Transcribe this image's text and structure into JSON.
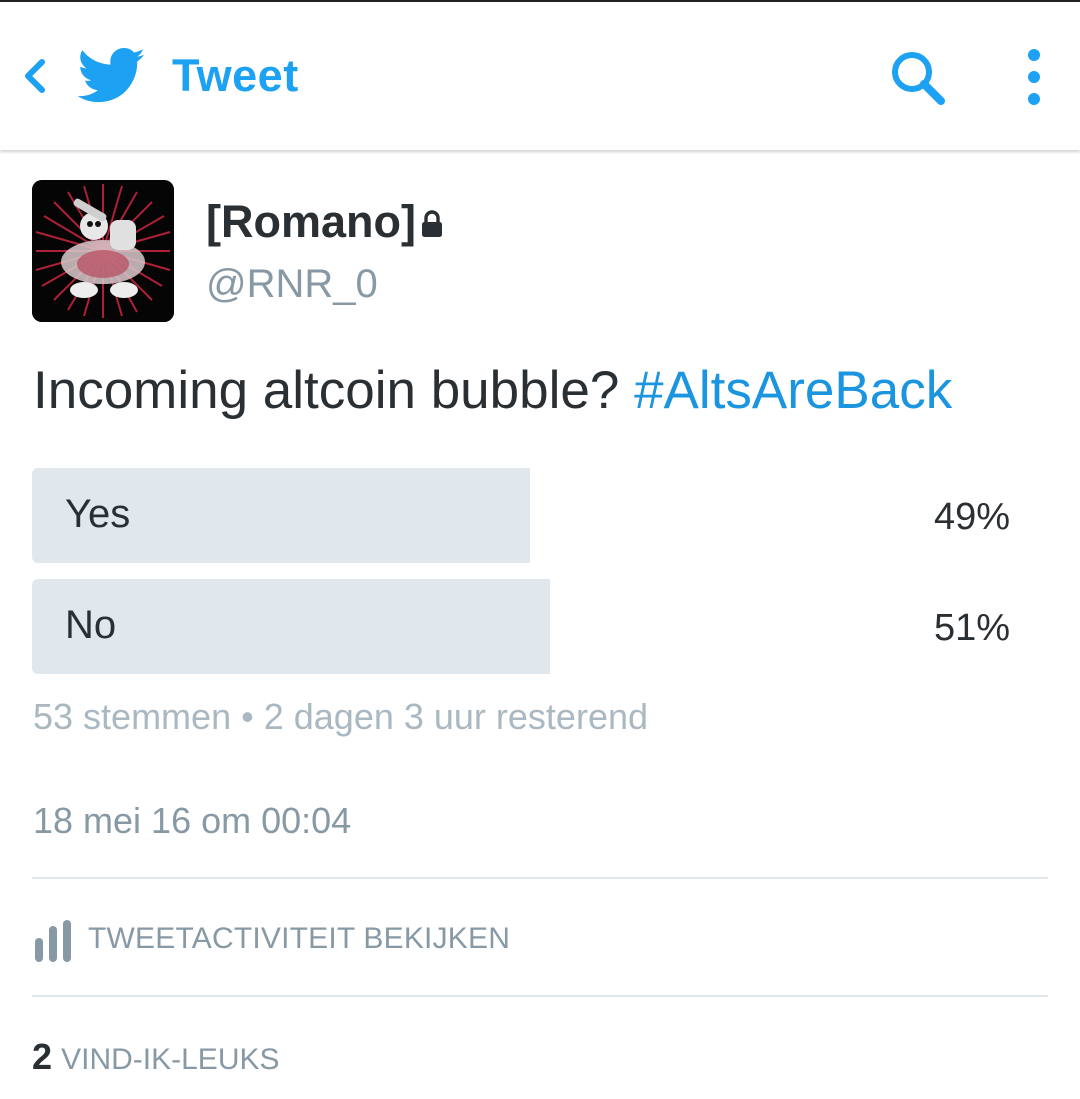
{
  "app_bar": {
    "title": "Tweet",
    "back_icon": "chevron-left-icon",
    "logo_icon": "twitter-bird-icon",
    "search_icon": "search-icon",
    "overflow_icon": "more-vertical-icon",
    "accent_color": "#1da1f2"
  },
  "author": {
    "display_name": "[Romano]",
    "handle": "@RNR_0",
    "protected_icon": "lock-icon"
  },
  "tweet": {
    "text": "Incoming altcoin bubble?",
    "hashtag": "#AltsAreBack"
  },
  "poll": {
    "options": [
      {
        "label": "Yes",
        "percent_label": "49%",
        "percent": 49
      },
      {
        "label": "No",
        "percent_label": "51%",
        "percent": 51
      }
    ],
    "votes": "53 stemmen",
    "separator": "•",
    "remaining": "2 dagen 3 uur resterend",
    "bar_color": "#e1e8ed"
  },
  "timestamp": "18 mei 16 om 00:04",
  "activity": {
    "label": "TWEETACTIVITEIT BEKIJKEN",
    "icon": "bar-chart-icon"
  },
  "likes": {
    "count": "2",
    "label": "VIND-IK-LEUKS"
  }
}
